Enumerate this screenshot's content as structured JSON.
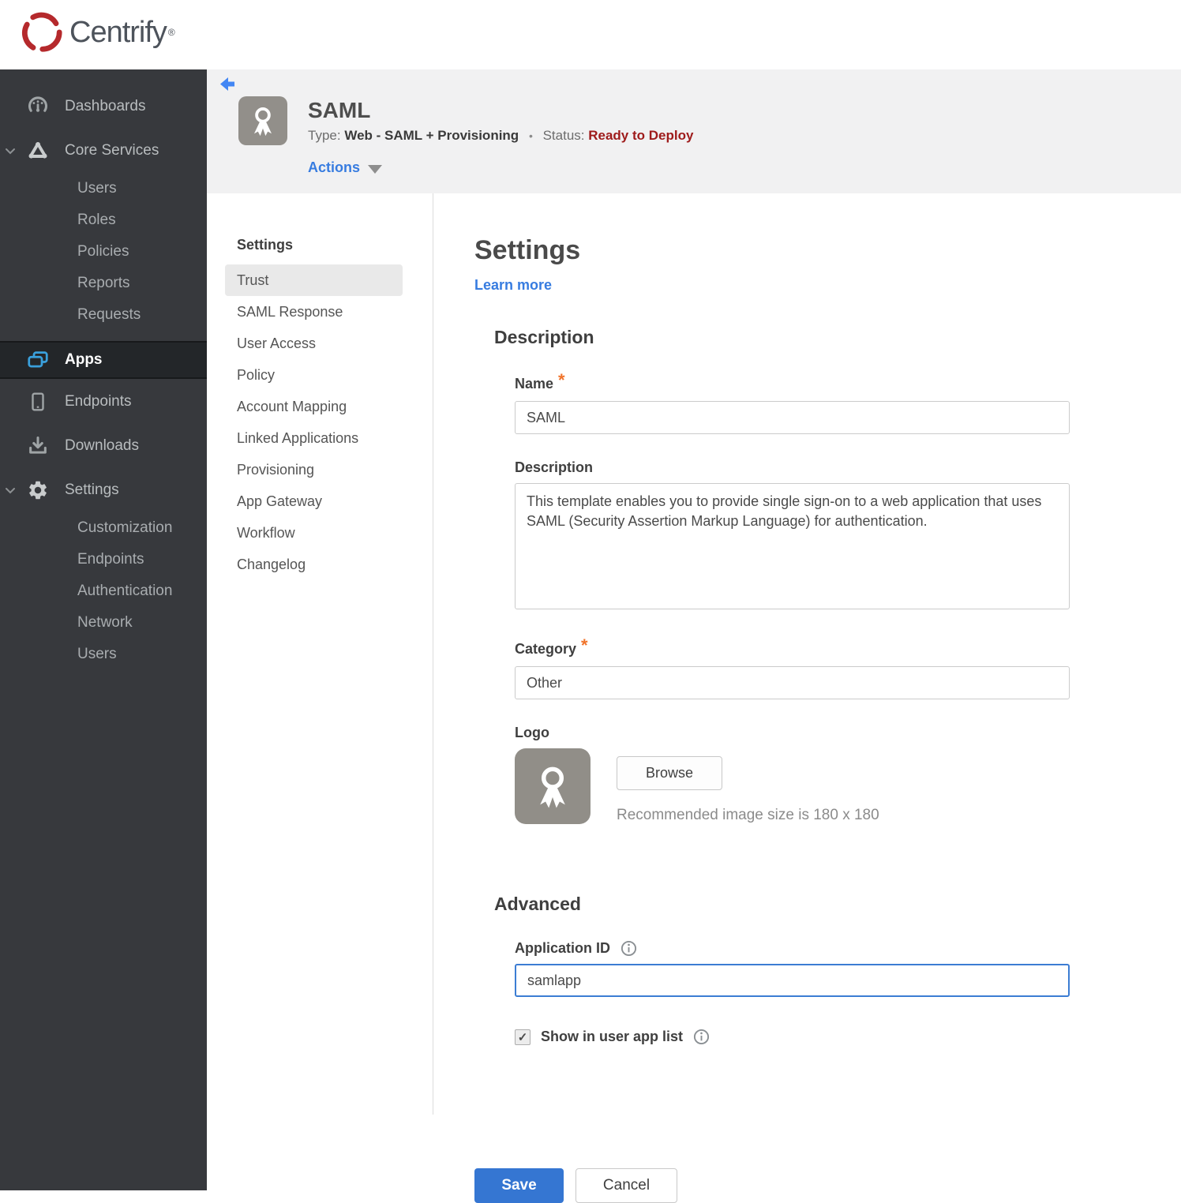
{
  "brand": {
    "name": "Centrify",
    "trademark": "®",
    "logo_color": "#b5292c"
  },
  "sidebar": {
    "dashboards": "Dashboards",
    "core_services": "Core Services",
    "core_children": [
      "Users",
      "Roles",
      "Policies",
      "Reports",
      "Requests"
    ],
    "apps": "Apps",
    "endpoints": "Endpoints",
    "downloads": "Downloads",
    "settings": "Settings",
    "settings_children": [
      "Customization",
      "Endpoints",
      "Authentication",
      "Network",
      "Users"
    ],
    "active_item": "Apps",
    "accent_color": "#3aa0dc"
  },
  "header": {
    "title": "SAML",
    "type_label": "Type:",
    "type_value": "Web - SAML + Provisioning",
    "separator": "•",
    "status_label": "Status:",
    "status_value": "Ready to Deploy",
    "status_color": "#9e1b1b",
    "actions_label": "Actions"
  },
  "subnav": {
    "heading": "Settings",
    "active": "Trust",
    "items": [
      "Trust",
      "SAML Response",
      "User Access",
      "Policy",
      "Account Mapping",
      "Linked Applications",
      "Provisioning",
      "App Gateway",
      "Workflow",
      "Changelog"
    ]
  },
  "main": {
    "title": "Settings",
    "learn_more": "Learn more",
    "required_marker": "*",
    "description": {
      "heading": "Description",
      "name_label": "Name",
      "name_value": "SAML",
      "description_label": "Description",
      "description_value": "This template enables you to provide single sign-on to a web application that uses SAML (Security Assertion Markup Language) for authentication.",
      "category_label": "Category",
      "category_value": "Other",
      "logo_label": "Logo",
      "browse_label": "Browse",
      "logo_hint": "Recommended image size is 180 x 180"
    },
    "advanced": {
      "heading": "Advanced",
      "application_id_label": "Application ID",
      "application_id_value": "samlapp",
      "checkbox_checked": true,
      "checkbox_glyph": "✓",
      "checkbox_label": "Show in user app list"
    },
    "footer": {
      "save_label": "Save",
      "cancel_label": "Cancel"
    }
  }
}
